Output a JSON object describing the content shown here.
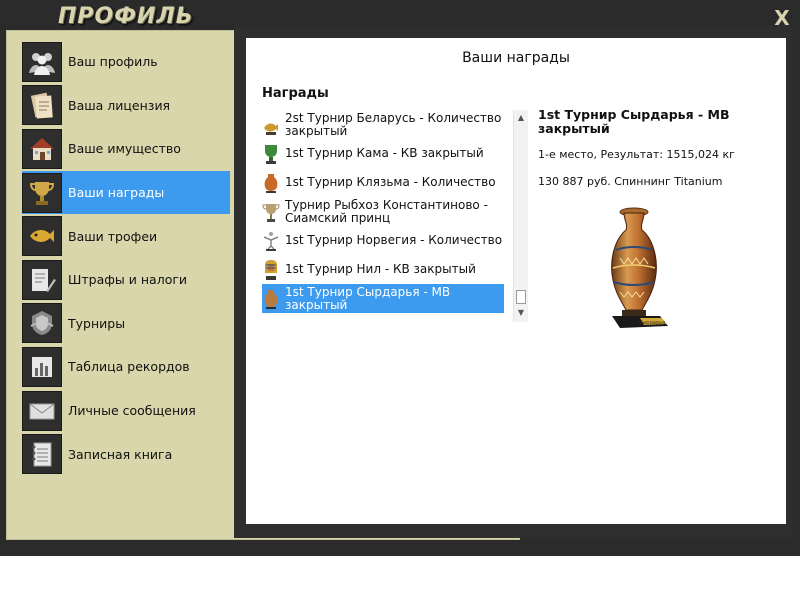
{
  "window": {
    "title": "ПРОФИЛЬ",
    "close_label": "X"
  },
  "sidebar": {
    "items": [
      {
        "label": "Ваш профиль",
        "icon": "users-icon",
        "active": false
      },
      {
        "label": "Ваша лицензия",
        "icon": "license-icon",
        "active": false
      },
      {
        "label": "Ваше имущество",
        "icon": "house-icon",
        "active": false
      },
      {
        "label": "Ваши награды",
        "icon": "trophy-icon",
        "active": true
      },
      {
        "label": "Ваши трофеи",
        "icon": "fish-icon",
        "active": false
      },
      {
        "label": "Штрафы и налоги",
        "icon": "document-pen-icon",
        "active": false
      },
      {
        "label": "Турниры",
        "icon": "tournament-badge-icon",
        "active": false
      },
      {
        "label": "Таблица рекордов",
        "icon": "bar-chart-icon",
        "active": false
      },
      {
        "label": "Личные сообщения",
        "icon": "envelope-icon",
        "active": false
      },
      {
        "label": "Записная книга",
        "icon": "notebook-icon",
        "active": false
      }
    ]
  },
  "main": {
    "title": "Ваши награды",
    "list_header": "Награды",
    "awards": [
      {
        "label": "2st Турнир Беларусь - Количество закрытый",
        "icon": "fish-award-icon",
        "selected": false
      },
      {
        "label": "1st Турнир Кама - КВ закрытый",
        "icon": "goblet-green-icon",
        "selected": false
      },
      {
        "label": "1st Турнир Клязьма - Количество",
        "icon": "vase-red-icon",
        "selected": false
      },
      {
        "label": "Турнир Рыбхоз Константиново - Сиамский принц",
        "icon": "cup-bronze-icon",
        "selected": false
      },
      {
        "label": "1st Турнир Норвегия - Количество",
        "icon": "figure-award-icon",
        "selected": false
      },
      {
        "label": "1st Турнир Нил - КВ закрытый",
        "icon": "pharaoh-icon",
        "selected": false
      },
      {
        "label": "1st Турнир Сырдарья - МВ закрытый",
        "icon": "vase-award-icon",
        "selected": true
      }
    ],
    "detail": {
      "title": "1st Турнир Сырдарья - МВ закрытый",
      "place_result": "1-е место, Результат: 1515,024 кг",
      "prize": "130 887 руб. Спиннинг Titanium",
      "image": "vase-trophy-image",
      "plaque_text": "Сырдарья"
    },
    "scroll": {
      "up": "▲",
      "down": "▼"
    },
    "colors": {
      "accent": "#3d9bef",
      "sidebar_bg": "#d8d6aa",
      "frame": "#2b2b2b"
    }
  }
}
